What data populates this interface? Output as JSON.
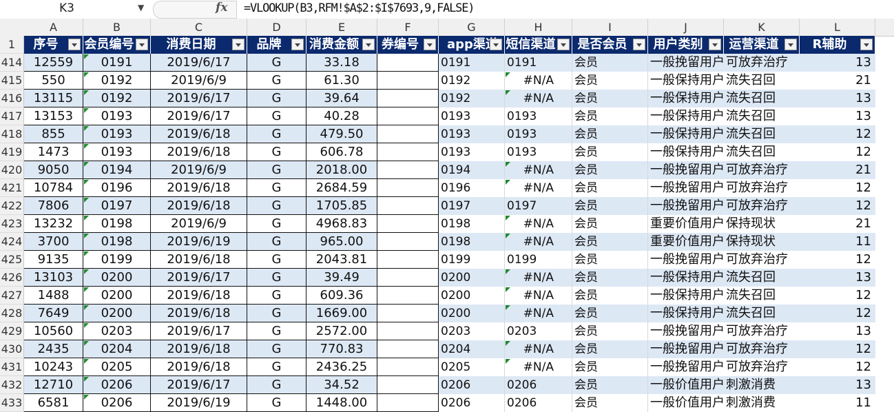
{
  "formula_bar": {
    "name_box": "K3",
    "fx_label": "fx",
    "formula": "=VLOOKUP(B3,RFM!$A$2:$I$7693,9,FALSE)"
  },
  "columns": [
    "A",
    "B",
    "C",
    "D",
    "E",
    "F",
    "G",
    "H",
    "I",
    "J",
    "K",
    "L"
  ],
  "header_row_number": "1",
  "headers": [
    "序号",
    "会员编号",
    "消费日期",
    "品牌",
    "消费金额",
    "券编号",
    "app渠道",
    "短信渠道",
    "是否会员",
    "用户类别",
    "运营渠道",
    "R辅助"
  ],
  "rows": [
    {
      "n": "414",
      "a": "12559",
      "b": "0191",
      "c": "2019/6/17",
      "d": "G",
      "e": "33.18",
      "g": "0191",
      "h": "0191",
      "i": "会员",
      "j": "一般挽留用户",
      "k": "可放弃治疗",
      "l": "13"
    },
    {
      "n": "415",
      "a": "550",
      "b": "0192",
      "c": "2019/6/9",
      "d": "G",
      "e": "61.30",
      "g": "0192",
      "h": "#N/A",
      "i": "会员",
      "j": "一般保持用户",
      "k": "流失召回",
      "l": "21"
    },
    {
      "n": "416",
      "a": "13115",
      "b": "0192",
      "c": "2019/6/17",
      "d": "G",
      "e": "39.64",
      "g": "0192",
      "h": "#N/A",
      "i": "会员",
      "j": "一般保持用户",
      "k": "流失召回",
      "l": "13"
    },
    {
      "n": "417",
      "a": "13153",
      "b": "0193",
      "c": "2019/6/17",
      "d": "G",
      "e": "40.28",
      "g": "0193",
      "h": "0193",
      "i": "会员",
      "j": "一般保持用户",
      "k": "流失召回",
      "l": "13"
    },
    {
      "n": "418",
      "a": "855",
      "b": "0193",
      "c": "2019/6/18",
      "d": "G",
      "e": "479.50",
      "g": "0193",
      "h": "0193",
      "i": "会员",
      "j": "一般保持用户",
      "k": "流失召回",
      "l": "12"
    },
    {
      "n": "419",
      "a": "1473",
      "b": "0193",
      "c": "2019/6/18",
      "d": "G",
      "e": "606.78",
      "g": "0193",
      "h": "0193",
      "i": "会员",
      "j": "一般保持用户",
      "k": "流失召回",
      "l": "12"
    },
    {
      "n": "420",
      "a": "9050",
      "b": "0194",
      "c": "2019/6/9",
      "d": "G",
      "e": "2018.00",
      "g": "0194",
      "h": "#N/A",
      "i": "会员",
      "j": "一般挽留用户",
      "k": "可放弃治疗",
      "l": "21"
    },
    {
      "n": "421",
      "a": "10784",
      "b": "0196",
      "c": "2019/6/18",
      "d": "G",
      "e": "2684.59",
      "g": "0196",
      "h": "#N/A",
      "i": "会员",
      "j": "一般挽留用户",
      "k": "可放弃治疗",
      "l": "12"
    },
    {
      "n": "422",
      "a": "7806",
      "b": "0197",
      "c": "2019/6/18",
      "d": "G",
      "e": "1705.85",
      "g": "0197",
      "h": "0197",
      "i": "会员",
      "j": "一般挽留用户",
      "k": "可放弃治疗",
      "l": "12"
    },
    {
      "n": "423",
      "a": "13232",
      "b": "0198",
      "c": "2019/6/9",
      "d": "G",
      "e": "4968.83",
      "g": "0198",
      "h": "#N/A",
      "i": "会员",
      "j": "重要价值用户",
      "k": "保持现状",
      "l": "21"
    },
    {
      "n": "424",
      "a": "3700",
      "b": "0198",
      "c": "2019/6/19",
      "d": "G",
      "e": "965.00",
      "g": "0198",
      "h": "#N/A",
      "i": "会员",
      "j": "重要价值用户",
      "k": "保持现状",
      "l": "11"
    },
    {
      "n": "425",
      "a": "9135",
      "b": "0199",
      "c": "2019/6/18",
      "d": "G",
      "e": "2043.81",
      "g": "0199",
      "h": "0199",
      "i": "会员",
      "j": "一般挽留用户",
      "k": "可放弃治疗",
      "l": "12"
    },
    {
      "n": "426",
      "a": "13103",
      "b": "0200",
      "c": "2019/6/17",
      "d": "G",
      "e": "39.49",
      "g": "0200",
      "h": "#N/A",
      "i": "会员",
      "j": "一般保持用户",
      "k": "流失召回",
      "l": "13"
    },
    {
      "n": "427",
      "a": "1488",
      "b": "0200",
      "c": "2019/6/18",
      "d": "G",
      "e": "609.36",
      "g": "0200",
      "h": "#N/A",
      "i": "会员",
      "j": "一般保持用户",
      "k": "流失召回",
      "l": "12"
    },
    {
      "n": "428",
      "a": "7649",
      "b": "0200",
      "c": "2019/6/18",
      "d": "G",
      "e": "1669.00",
      "g": "0200",
      "h": "#N/A",
      "i": "会员",
      "j": "一般保持用户",
      "k": "流失召回",
      "l": "12"
    },
    {
      "n": "429",
      "a": "10560",
      "b": "0203",
      "c": "2019/6/17",
      "d": "G",
      "e": "2572.00",
      "g": "0203",
      "h": "0203",
      "i": "会员",
      "j": "一般挽留用户",
      "k": "可放弃治疗",
      "l": "13"
    },
    {
      "n": "430",
      "a": "2435",
      "b": "0204",
      "c": "2019/6/18",
      "d": "G",
      "e": "770.83",
      "g": "0204",
      "h": "#N/A",
      "i": "会员",
      "j": "一般挽留用户",
      "k": "可放弃治疗",
      "l": "12"
    },
    {
      "n": "431",
      "a": "10243",
      "b": "0205",
      "c": "2019/6/18",
      "d": "G",
      "e": "2436.25",
      "g": "0205",
      "h": "#N/A",
      "i": "会员",
      "j": "一般挽留用户",
      "k": "可放弃治疗",
      "l": "12"
    },
    {
      "n": "432",
      "a": "12710",
      "b": "0206",
      "c": "2019/6/17",
      "d": "G",
      "e": "34.52",
      "g": "0206",
      "h": "0206",
      "i": "会员",
      "j": "一般价值用户",
      "k": "刺激消费",
      "l": "13"
    },
    {
      "n": "433",
      "a": "6581",
      "b": "0206",
      "c": "2019/6/19",
      "d": "G",
      "e": "1448.00",
      "g": "0206",
      "h": "0206",
      "i": "会员",
      "j": "一般价值用户",
      "k": "刺激消费",
      "l": "11"
    }
  ],
  "colors": {
    "header_fill": "#0b2a6e",
    "band_fill": "#dde8f5",
    "error_marker": "#1e8a2e"
  }
}
